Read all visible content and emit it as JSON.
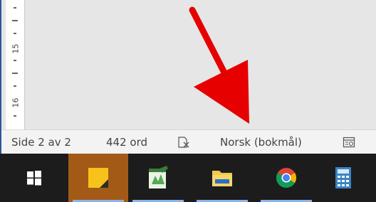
{
  "ruler": {
    "labels": [
      "15",
      "16"
    ]
  },
  "statusbar": {
    "page": "Side 2 av 2",
    "words": "442 ord",
    "proofing_icon": "proofing-icon",
    "language": "Norsk (bokmål)",
    "view_icon": "read-mode-icon"
  },
  "taskbar": {
    "items": [
      {
        "name": "windows-start-icon"
      },
      {
        "name": "sticky-notes-icon",
        "active": true
      },
      {
        "name": "project-app-icon"
      },
      {
        "name": "file-explorer-icon"
      },
      {
        "name": "chrome-icon"
      },
      {
        "name": "calculator-icon"
      }
    ]
  },
  "colors": {
    "arrow": "#e60000",
    "taskbar": "#1c1c1c",
    "active_task": "#a35a17",
    "window_border": "#2b579a"
  }
}
